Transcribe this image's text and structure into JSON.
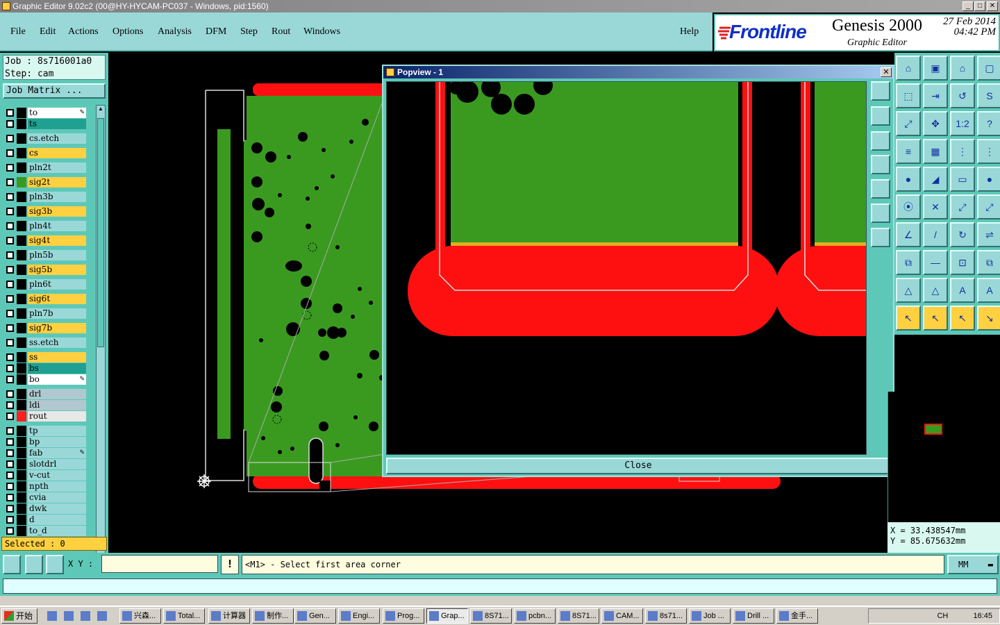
{
  "window": {
    "title": "Graphic Editor 9.02c2 (00@HY-HYCAM-PC037 - Windows, pid:1560)",
    "buttons": [
      "_",
      "□",
      "✕"
    ]
  },
  "menu": [
    "File",
    "Edit",
    "Actions",
    "Options",
    "Analysis",
    "DFM",
    "Step",
    "Rout",
    "Windows"
  ],
  "help": "Help",
  "brand": {
    "logo": "Frontline",
    "product": "Genesis 2000",
    "subtitle": "Graphic Editor",
    "date": "27 Feb 2014",
    "time": "04:42 PM"
  },
  "job": {
    "job_line": "Job : 8s716001a0",
    "step_line": "Step: cam",
    "matrix_button": "Job Matrix ..."
  },
  "layers": [
    {
      "name": "to",
      "color": "#ffffff",
      "swatch": "#000000",
      "edit": true
    },
    {
      "name": "ts",
      "color": "#20a090",
      "swatch": "#000000"
    },
    {
      "name": "cs.etch",
      "color": "#9ad8d8",
      "swatch": "#000000"
    },
    {
      "name": "cs",
      "color": "#ffd040",
      "swatch": "#000000"
    },
    {
      "name": "pln2t",
      "color": "#9ad8d8",
      "swatch": "#000000"
    },
    {
      "name": "sig2t",
      "color": "#ffd040",
      "swatch": "#3a9a20"
    },
    {
      "name": "pln3b",
      "color": "#9ad8d8",
      "swatch": "#000000"
    },
    {
      "name": "sig3b",
      "color": "#ffd040",
      "swatch": "#000000"
    },
    {
      "name": "pln4t",
      "color": "#9ad8d8",
      "swatch": "#000000"
    },
    {
      "name": "sig4t",
      "color": "#ffd040",
      "swatch": "#000000"
    },
    {
      "name": "pln5b",
      "color": "#9ad8d8",
      "swatch": "#000000"
    },
    {
      "name": "sig5b",
      "color": "#ffd040",
      "swatch": "#000000"
    },
    {
      "name": "pln6t",
      "color": "#9ad8d8",
      "swatch": "#000000"
    },
    {
      "name": "sig6t",
      "color": "#ffd040",
      "swatch": "#000000"
    },
    {
      "name": "pln7b",
      "color": "#9ad8d8",
      "swatch": "#000000"
    },
    {
      "name": "sig7b",
      "color": "#ffd040",
      "swatch": "#000000"
    },
    {
      "name": "ss.etch",
      "color": "#9ad8d8",
      "swatch": "#000000"
    },
    {
      "name": "ss",
      "color": "#ffd040",
      "swatch": "#000000"
    },
    {
      "name": "bs",
      "color": "#20a090",
      "swatch": "#000000"
    },
    {
      "name": "bo",
      "color": "#ffffff",
      "swatch": "#000000",
      "edit": true
    },
    {
      "name": "drl",
      "color": "#b0c8d0",
      "swatch": "#000000"
    },
    {
      "name": "ldi",
      "color": "#b0c8d0",
      "swatch": "#000000"
    },
    {
      "name": "rout",
      "color": "#e8e8e8",
      "swatch": "#ff2020",
      "active": true
    },
    {
      "name": "tp",
      "color": "#9ad8d8",
      "swatch": "#000000"
    },
    {
      "name": "bp",
      "color": "#9ad8d8",
      "swatch": "#000000"
    },
    {
      "name": "fab",
      "color": "#9ad8d8",
      "swatch": "#000000",
      "edit": true
    },
    {
      "name": "slotdrl",
      "color": "#9ad8d8",
      "swatch": "#000000"
    },
    {
      "name": "v-cut",
      "color": "#9ad8d8",
      "swatch": "#000000"
    },
    {
      "name": "npth",
      "color": "#9ad8d8",
      "swatch": "#000000"
    },
    {
      "name": "cvia",
      "color": "#9ad8d8",
      "swatch": "#000000"
    },
    {
      "name": "dwk",
      "color": "#9ad8d8",
      "swatch": "#000000"
    },
    {
      "name": "d",
      "color": "#9ad8d8",
      "swatch": "#000000"
    },
    {
      "name": "to_d",
      "color": "#9ad8d8",
      "swatch": "#000000"
    }
  ],
  "selected": "Selected : 0",
  "popview": {
    "title": "Popview - 1",
    "close_label": "Close"
  },
  "coords": {
    "x": "X = 33.438547mm",
    "y": "Y = 85.675632mm"
  },
  "status": {
    "xy_label": "X Y :",
    "xy_value": "",
    "message": "<M1> - Select first area corner",
    "units": "MM",
    "warn": "!"
  },
  "taskbar": {
    "start": "开始",
    "tasks": [
      "兴森...",
      "Total...",
      "计算器",
      "制作...",
      "Gen...",
      "Engi...",
      "Prog...",
      "Grap...",
      "8S71...",
      "pcbn...",
      "8S71...",
      "CAM...",
      "8s71...",
      "Job ...",
      "Drill ...",
      "金手..."
    ],
    "active_task": 7,
    "lang": "CH",
    "clock": "16:45"
  }
}
